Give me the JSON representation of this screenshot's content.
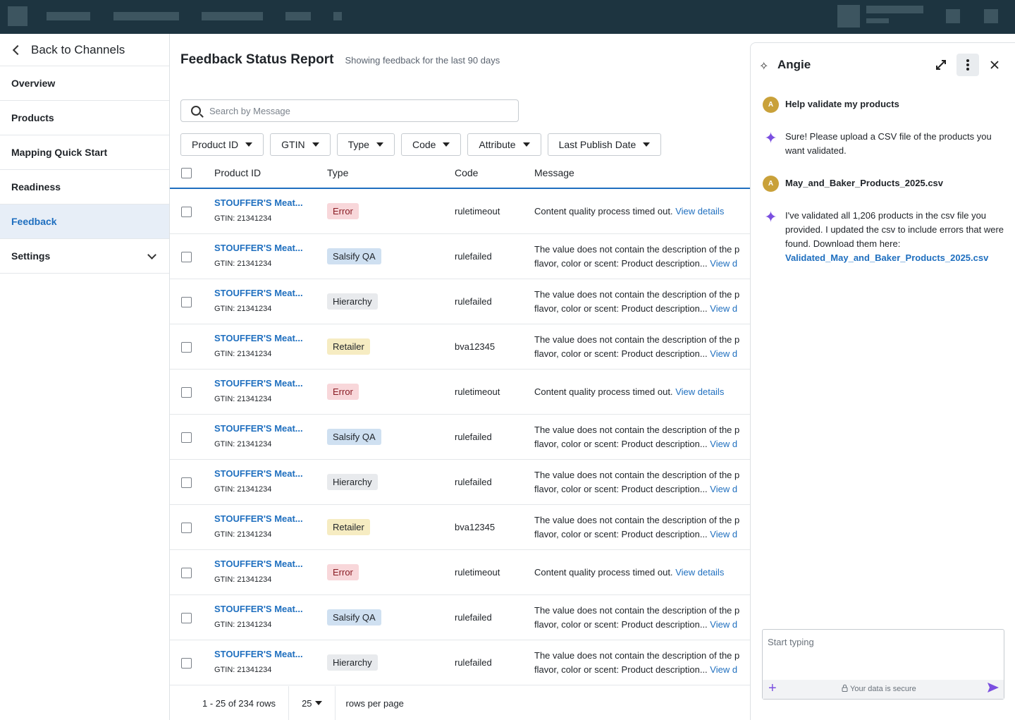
{
  "sidebar": {
    "back_label": "Back to Channels",
    "items": [
      {
        "label": "Overview"
      },
      {
        "label": "Products"
      },
      {
        "label": "Mapping Quick Start"
      },
      {
        "label": "Readiness"
      },
      {
        "label": "Feedback"
      },
      {
        "label": "Settings"
      }
    ]
  },
  "main": {
    "title": "Feedback Status Report",
    "subtitle": "Showing feedback for the last 90 days",
    "search_placeholder": "Search by Message",
    "filters": [
      "Product ID",
      "GTIN",
      "Type",
      "Code",
      "Attribute",
      "Last Publish Date"
    ],
    "columns": [
      "Product ID",
      "Type",
      "Code",
      "Message"
    ],
    "rows": [
      {
        "product": "STOUFFER'S Meat...",
        "gtin": "GTIN: 21341234",
        "type": "Error",
        "code": "ruletimeout",
        "msg1": "Content quality process timed out.",
        "msg2": "",
        "link": "View details"
      },
      {
        "product": "STOUFFER'S Meat...",
        "gtin": "GTIN: 21341234",
        "type": "Salsify QA",
        "code": "rulefailed",
        "msg1": "The value does not contain the description of the p",
        "msg2": "flavor, color or scent: Product description...",
        "link": "View d"
      },
      {
        "product": "STOUFFER'S Meat...",
        "gtin": "GTIN: 21341234",
        "type": "Hierarchy",
        "code": "rulefailed",
        "msg1": "The value does not contain the description of the p",
        "msg2": "flavor, color or scent: Product description...",
        "link": "View d"
      },
      {
        "product": "STOUFFER'S Meat...",
        "gtin": "GTIN: 21341234",
        "type": "Retailer",
        "code": "bva12345",
        "msg1": "The value does not contain the description of the p",
        "msg2": "flavor, color or scent: Product description...",
        "link": "View d"
      },
      {
        "product": "STOUFFER'S Meat...",
        "gtin": "GTIN: 21341234",
        "type": "Error",
        "code": "ruletimeout",
        "msg1": "Content quality process timed out.",
        "msg2": "",
        "link": "View details"
      },
      {
        "product": "STOUFFER'S Meat...",
        "gtin": "GTIN: 21341234",
        "type": "Salsify QA",
        "code": "rulefailed",
        "msg1": "The value does not contain the description of the p",
        "msg2": "flavor, color or scent: Product description...",
        "link": "View d"
      },
      {
        "product": "STOUFFER'S Meat...",
        "gtin": "GTIN: 21341234",
        "type": "Hierarchy",
        "code": "rulefailed",
        "msg1": "The value does not contain the description of the p",
        "msg2": "flavor, color or scent: Product description...",
        "link": "View d"
      },
      {
        "product": "STOUFFER'S Meat...",
        "gtin": "GTIN: 21341234",
        "type": "Retailer",
        "code": "bva12345",
        "msg1": "The value does not contain the description of the p",
        "msg2": "flavor, color or scent: Product description...",
        "link": "View d"
      },
      {
        "product": "STOUFFER'S Meat...",
        "gtin": "GTIN: 21341234",
        "type": "Error",
        "code": "ruletimeout",
        "msg1": "Content quality process timed out.",
        "msg2": "",
        "link": "View details"
      },
      {
        "product": "STOUFFER'S Meat...",
        "gtin": "GTIN: 21341234",
        "type": "Salsify QA",
        "code": "rulefailed",
        "msg1": "The value does not contain the description of the p",
        "msg2": "flavor, color or scent: Product description...",
        "link": "View d"
      },
      {
        "product": "STOUFFER'S Meat...",
        "gtin": "GTIN: 21341234",
        "type": "Hierarchy",
        "code": "rulefailed",
        "msg1": "The value does not contain the description of the p",
        "msg2": "flavor, color or scent: Product description...",
        "link": "View d"
      }
    ],
    "pager": {
      "range": "1 - 25 of 234 rows",
      "page_size": "25",
      "suffix": "rows per page"
    }
  },
  "badge_colors": {
    "Error": {
      "bg": "#f8d7da",
      "fg": "#8a1c24"
    },
    "Salsify QA": {
      "bg": "#cfe0f1",
      "fg": "#1f2328"
    },
    "Hierarchy": {
      "bg": "#e8eaed",
      "fg": "#1f2328"
    },
    "Retailer": {
      "bg": "#f6ecc2",
      "fg": "#1f2328"
    }
  },
  "chat": {
    "title": "Angie",
    "avatar_letter": "A",
    "messages": [
      {
        "from": "user",
        "text": "Help validate my products"
      },
      {
        "from": "ai",
        "text": "Sure! Please upload a CSV file of the products you want validated."
      },
      {
        "from": "user",
        "text": "May_and_Baker_Products_2025.csv"
      },
      {
        "from": "ai",
        "text": "I've validated all 1,206 products in the csv file you provided. I updated the csv to include errors that were found. Download them here:",
        "link": "Validated_May_and_Baker_Products_2025.csv"
      }
    ],
    "input_placeholder": "Start typing",
    "secure_text": "Your data is secure"
  },
  "icons": {
    "back": "chevron-left-icon",
    "search": "search-icon",
    "sparkle": "sparkle-icon",
    "expand": "expand-icon",
    "more": "more-vertical-icon",
    "close": "close-icon",
    "plus": "plus-icon",
    "lock": "lock-icon",
    "send": "send-icon"
  },
  "colors": {
    "topbar": "#1d3440",
    "accent": "#1f6fbf",
    "ai": "#7b4fe0"
  }
}
